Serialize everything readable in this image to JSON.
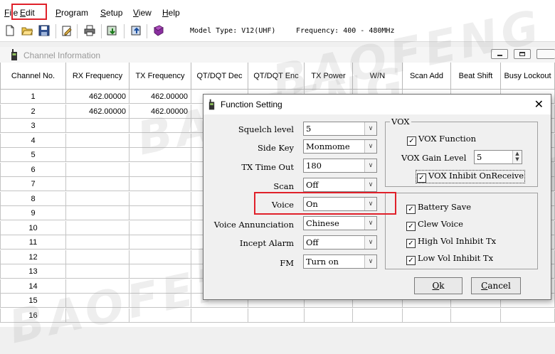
{
  "menubar": {
    "items": [
      {
        "mn": "F",
        "rest": "ile"
      },
      {
        "mn": "E",
        "rest": "dit"
      },
      {
        "mn": "P",
        "rest": "rogram"
      },
      {
        "mn": "S",
        "rest": "etup"
      },
      {
        "mn": "V",
        "rest": "iew"
      },
      {
        "mn": "H",
        "rest": "elp"
      }
    ]
  },
  "toolbar": {
    "model_type": "Model Type: V12(UHF)",
    "frequency": "Frequency: 400 - 480MHz"
  },
  "channel_window": {
    "title": "Channel Information",
    "columns": [
      "Channel No.",
      "RX Frequency",
      "TX Frequency",
      "QT/DQT Dec",
      "QT/DQT Enc",
      "TX Power",
      "W/N",
      "Scan Add",
      "Beat Shift",
      "Busy Lockout"
    ],
    "rows": [
      [
        "1",
        "462.00000",
        "462.00000"
      ],
      [
        "2",
        "462.00000",
        "462.00000"
      ],
      [
        "3",
        "",
        ""
      ],
      [
        "4",
        "",
        ""
      ],
      [
        "5",
        "",
        ""
      ],
      [
        "6",
        "",
        ""
      ],
      [
        "7",
        "",
        ""
      ],
      [
        "8",
        "",
        ""
      ],
      [
        "9",
        "",
        ""
      ],
      [
        "10",
        "",
        ""
      ],
      [
        "11",
        "",
        ""
      ],
      [
        "12",
        "",
        ""
      ],
      [
        "13",
        "",
        ""
      ],
      [
        "14",
        "",
        ""
      ],
      [
        "15",
        "",
        ""
      ],
      [
        "16",
        "",
        ""
      ]
    ]
  },
  "watermark": "BAOFENG",
  "dialog": {
    "title": "Function Setting",
    "fields": {
      "squelch_label": "Squelch level",
      "squelch_value": "5",
      "sidekey_label": "Side Key",
      "sidekey_value": "Monmome",
      "txtimeout_label": "TX Time Out",
      "txtimeout_value": "180",
      "scan_label": "Scan",
      "scan_value": "Off",
      "voice_label": "Voice",
      "voice_value": "On",
      "annunciation_label": "Voice Annunciation",
      "annunciation_value": "Chinese",
      "incept_label": "Incept Alarm",
      "incept_value": "Off",
      "fm_label": "FM",
      "fm_value": "Turn on"
    },
    "vox": {
      "group_label": "VOX",
      "function_label": "VOX Function",
      "gain_label": "VOX Gain Level",
      "gain_value": "5",
      "inhibit_label": "VOX Inhibit OnReceive"
    },
    "options": {
      "battery_save": "Battery Save",
      "clew_voice": "Clew Voice",
      "high_vol": "High Vol Inhibit Tx",
      "low_vol": "Low Vol Inhibit Tx"
    },
    "ok": {
      "mn": "O",
      "rest": "k"
    },
    "cancel": {
      "mn": "C",
      "rest": "ancel"
    }
  }
}
